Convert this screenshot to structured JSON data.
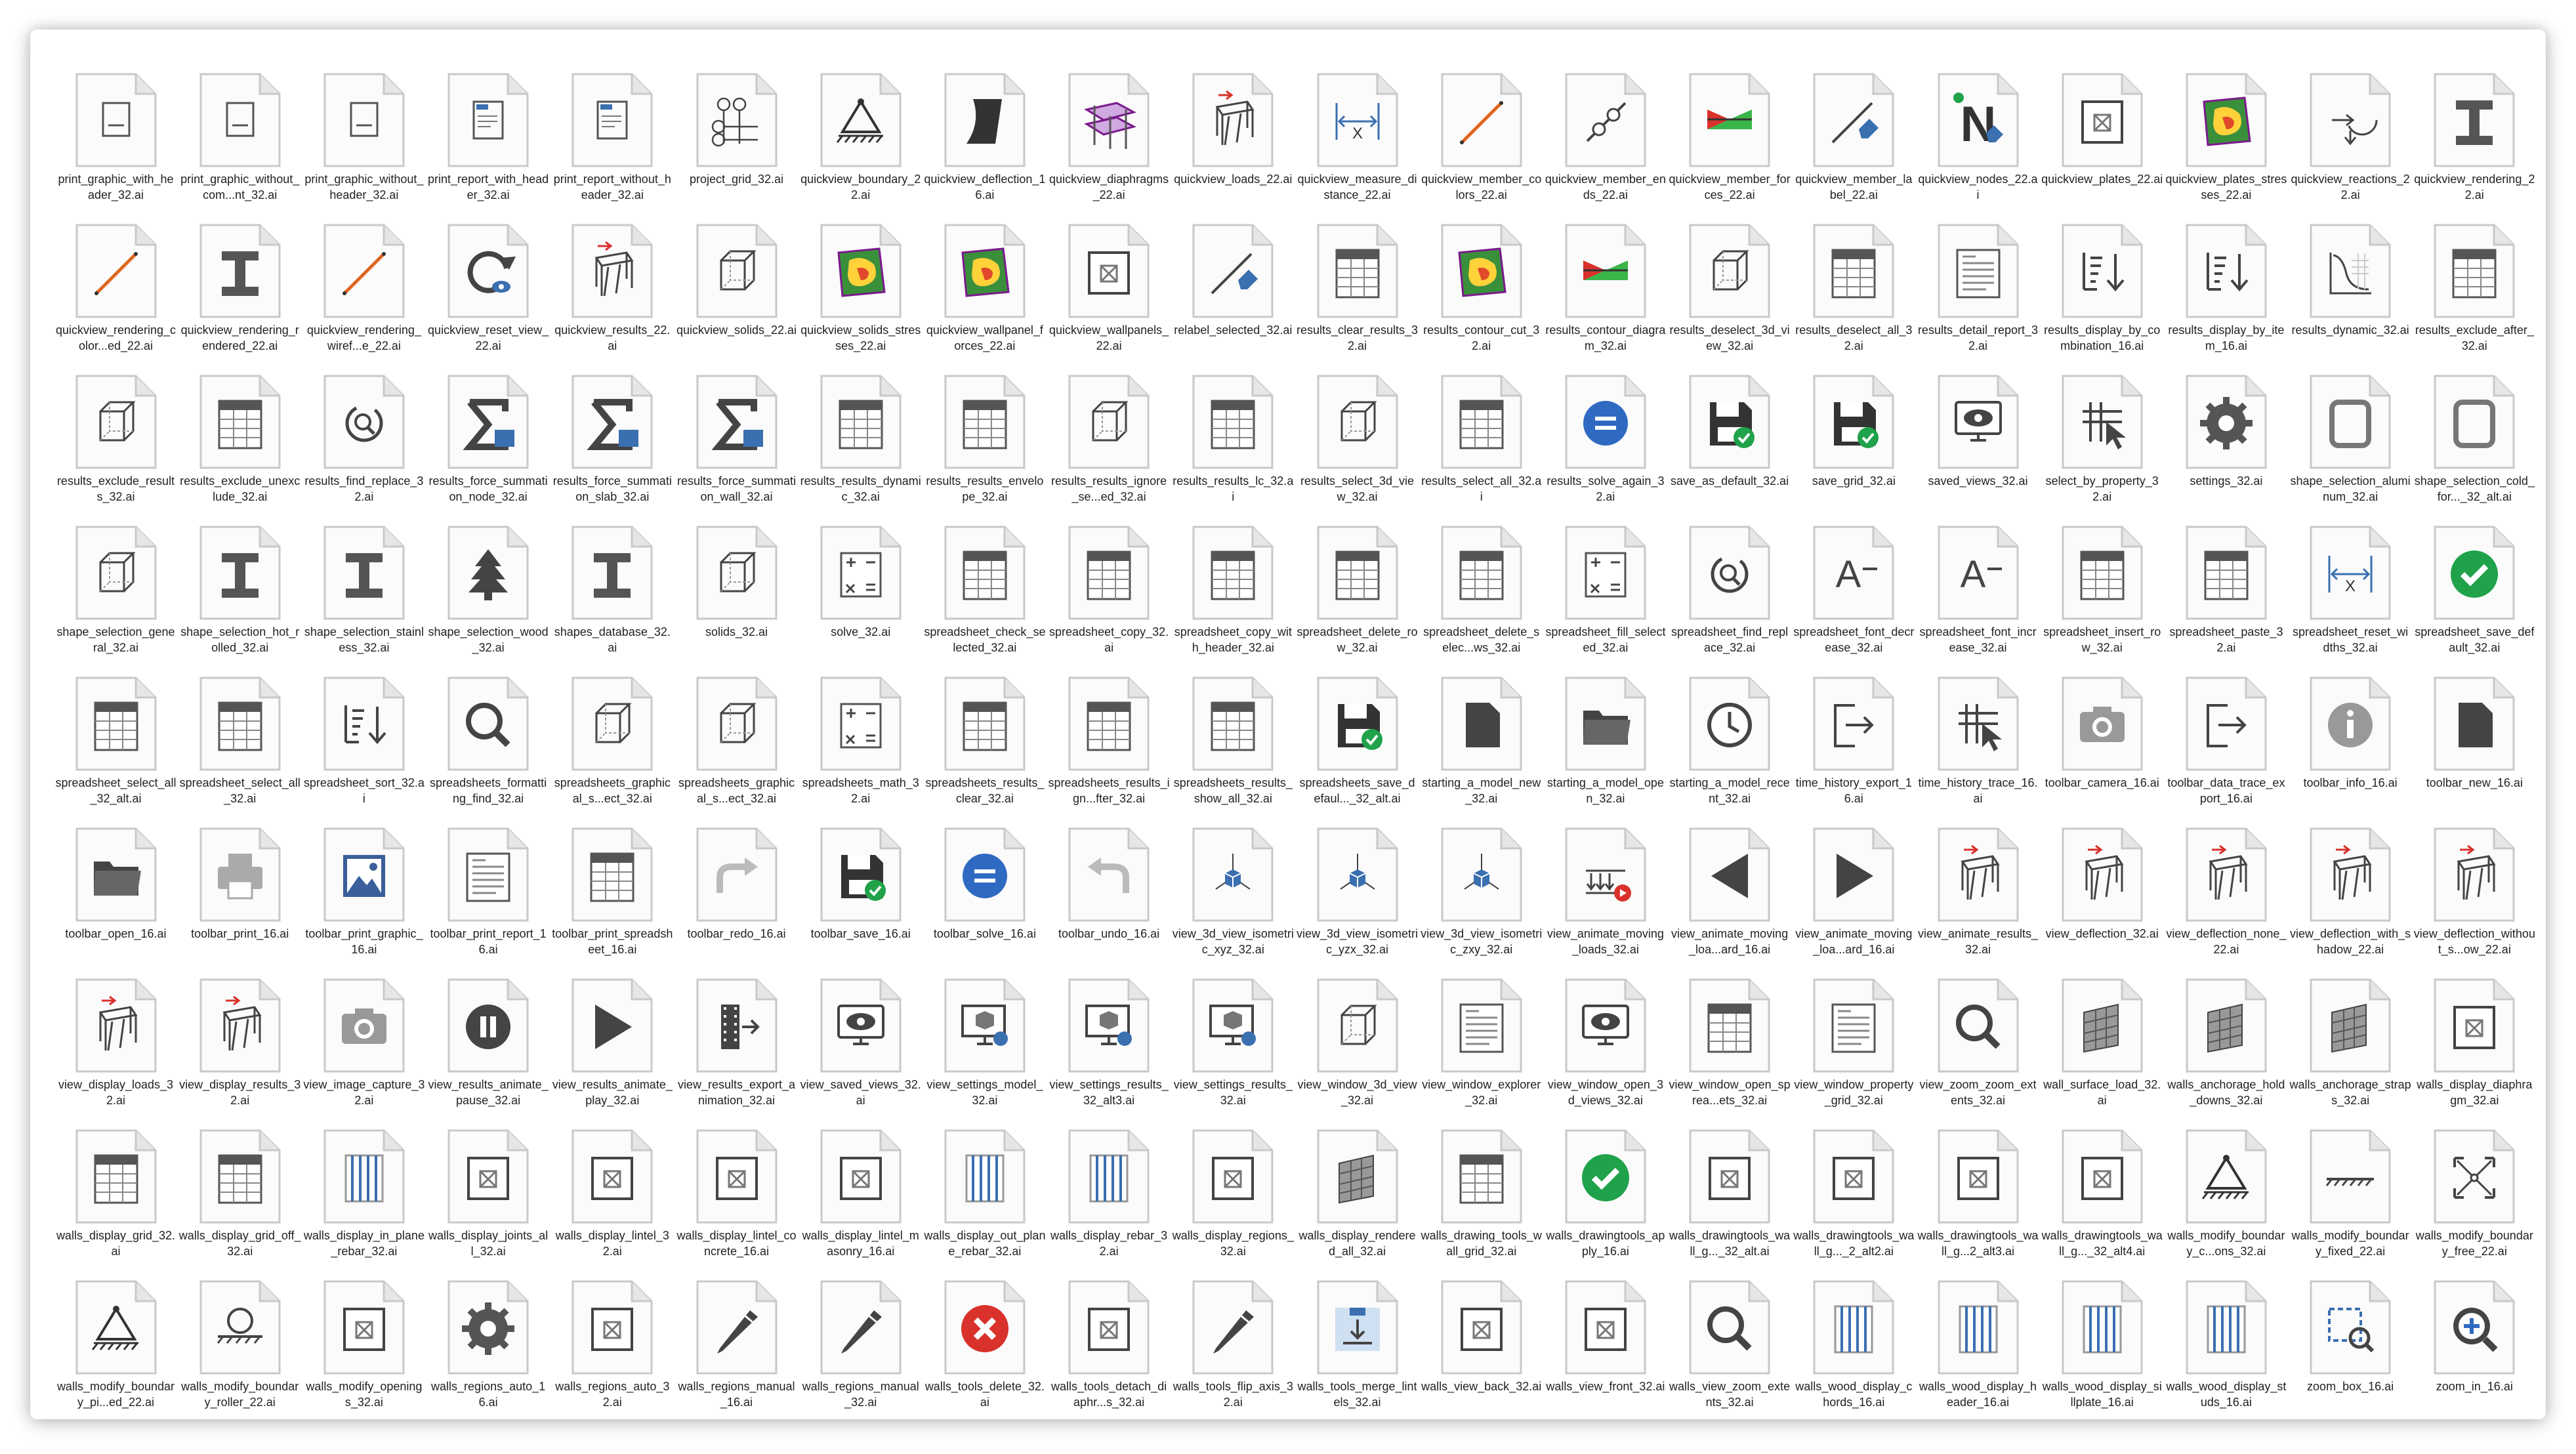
{
  "files": [
    {
      "icon": "print-graphic-icon",
      "name": "print_graphic_with_header_32.ai"
    },
    {
      "icon": "print-graphic-icon",
      "name": "print_graphic_without_com...nt_32.ai"
    },
    {
      "icon": "print-graphic-icon",
      "name": "print_graphic_without_header_32.ai"
    },
    {
      "icon": "print-report-icon",
      "name": "print_report_with_header_32.ai"
    },
    {
      "icon": "print-report-icon",
      "name": "print_report_without_header_32.ai"
    },
    {
      "icon": "grid-icon",
      "name": "project_grid_32.ai"
    },
    {
      "icon": "boundary-icon",
      "name": "quickview_boundary_22.ai"
    },
    {
      "icon": "deflection-icon",
      "name": "quickview_deflection_16.ai"
    },
    {
      "icon": "diaphragm-icon",
      "name": "quickview_diaphragms_22.ai"
    },
    {
      "icon": "frame-icon",
      "name": "quickview_loads_22.ai"
    },
    {
      "icon": "measure-icon",
      "name": "quickview_measure_distance_22.ai"
    },
    {
      "icon": "line-icon",
      "name": "quickview_member_colors_22.ai"
    },
    {
      "icon": "member-ends-icon",
      "name": "quickview_member_ends_22.ai"
    },
    {
      "icon": "forces-icon",
      "name": "quickview_member_forces_22.ai"
    },
    {
      "icon": "tag-icon",
      "name": "quickview_member_label_22.ai"
    },
    {
      "icon": "node-icon",
      "name": "quickview_nodes_22.ai"
    },
    {
      "icon": "plate-icon",
      "name": "quickview_plates_22.ai"
    },
    {
      "icon": "contour-icon",
      "name": "quickview_plates_stresses_22.ai"
    },
    {
      "icon": "reaction-icon",
      "name": "quickview_reactions_22.ai"
    },
    {
      "icon": "ibeam-icon",
      "name": "quickview_rendering_22.ai"
    },
    {
      "icon": "line-icon",
      "name": "quickview_rendering_color...ed_22.ai"
    },
    {
      "icon": "ibeam-icon",
      "name": "quickview_rendering_rendered_22.ai"
    },
    {
      "icon": "line-icon",
      "name": "quickview_rendering_wiref...e_22.ai"
    },
    {
      "icon": "refresh-icon",
      "name": "quickview_reset_view_22.ai"
    },
    {
      "icon": "frame-icon",
      "name": "quickview_results_22.ai"
    },
    {
      "icon": "cube-icon",
      "name": "quickview_solids_22.ai"
    },
    {
      "icon": "contour-icon",
      "name": "quickview_solids_stresses_22.ai"
    },
    {
      "icon": "contour-icon",
      "name": "quickview_wallpanel_forces_22.ai"
    },
    {
      "icon": "plate-icon",
      "name": "quickview_wallpanels_22.ai"
    },
    {
      "icon": "tag-icon",
      "name": "relabel_selected_32.ai"
    },
    {
      "icon": "table-icon",
      "name": "results_clear_results_32.ai"
    },
    {
      "icon": "contour-icon",
      "name": "results_contour_cut_32.ai"
    },
    {
      "icon": "forces-icon",
      "name": "results_contour_diagram_32.ai"
    },
    {
      "icon": "cube-icon",
      "name": "results_deselect_3d_view_32.ai"
    },
    {
      "icon": "table-icon",
      "name": "results_deselect_all_32.ai"
    },
    {
      "icon": "report-icon",
      "name": "results_detail_report_32.ai"
    },
    {
      "icon": "sort-icon",
      "name": "results_display_by_combination_16.ai"
    },
    {
      "icon": "sort-icon",
      "name": "results_display_by_item_16.ai"
    },
    {
      "icon": "chart-icon",
      "name": "results_dynamic_32.ai"
    },
    {
      "icon": "table-icon",
      "name": "results_exclude_after_32.ai"
    },
    {
      "icon": "cube-icon",
      "name": "results_exclude_results_32.ai"
    },
    {
      "icon": "table-icon",
      "name": "results_exclude_unexclude_32.ai"
    },
    {
      "icon": "find-icon",
      "name": "results_find_replace_32.ai"
    },
    {
      "icon": "sigma-icon",
      "name": "results_force_summation_node_32.ai"
    },
    {
      "icon": "sigma-icon",
      "name": "results_force_summation_slab_32.ai"
    },
    {
      "icon": "sigma-icon",
      "name": "results_force_summation_wall_32.ai"
    },
    {
      "icon": "table-icon",
      "name": "results_results_dynamic_32.ai"
    },
    {
      "icon": "table-icon",
      "name": "results_results_envelope_32.ai"
    },
    {
      "icon": "cube-icon",
      "name": "results_results_ignore_se...ed_32.ai"
    },
    {
      "icon": "table-icon",
      "name": "results_results_lc_32.ai"
    },
    {
      "icon": "cube-icon",
      "name": "results_select_3d_view_32.ai"
    },
    {
      "icon": "table-icon",
      "name": "results_select_all_32.ai"
    },
    {
      "icon": "stop-icon",
      "name": "results_solve_again_32.ai"
    },
    {
      "icon": "save-icon",
      "name": "save_as_default_32.ai"
    },
    {
      "icon": "save-icon",
      "name": "save_grid_32.ai"
    },
    {
      "icon": "eye-icon",
      "name": "saved_views_32.ai"
    },
    {
      "icon": "select-icon",
      "name": "select_by_property_32.ai"
    },
    {
      "icon": "gear-icon",
      "name": "settings_32.ai"
    },
    {
      "icon": "shape-icon",
      "name": "shape_selection_aluminum_32.ai"
    },
    {
      "icon": "shape-icon",
      "name": "shape_selection_cold_for..._32_alt.ai"
    },
    {
      "icon": "cube-icon",
      "name": "shape_selection_general_32.ai"
    },
    {
      "icon": "ibeam-icon",
      "name": "shape_selection_hot_rolled_32.ai"
    },
    {
      "icon": "ibeam-icon",
      "name": "shape_selection_stainless_32.ai"
    },
    {
      "icon": "tree-icon",
      "name": "shape_selection_wood_32.ai"
    },
    {
      "icon": "ibeam-icon",
      "name": "shapes_database_32.ai"
    },
    {
      "icon": "cube-icon",
      "name": "solids_32.ai"
    },
    {
      "icon": "calc-icon",
      "name": "solve_32.ai"
    },
    {
      "icon": "table-icon",
      "name": "spreadsheet_check_selected_32.ai"
    },
    {
      "icon": "table-icon",
      "name": "spreadsheet_copy_32.ai"
    },
    {
      "icon": "table-icon",
      "name": "spreadsheet_copy_with_header_32.ai"
    },
    {
      "icon": "table-icon",
      "name": "spreadsheet_delete_row_32.ai"
    },
    {
      "icon": "table-icon",
      "name": "spreadsheet_delete_selec...ws_32.ai"
    },
    {
      "icon": "calc-icon",
      "name": "spreadsheet_fill_selected_32.ai"
    },
    {
      "icon": "find-icon",
      "name": "spreadsheet_find_replace_32.ai"
    },
    {
      "icon": "font-icon",
      "name": "spreadsheet_font_decrease_32.ai"
    },
    {
      "icon": "font-icon",
      "name": "spreadsheet_font_increase_32.ai"
    },
    {
      "icon": "table-icon",
      "name": "spreadsheet_insert_row_32.ai"
    },
    {
      "icon": "table-icon",
      "name": "spreadsheet_paste_32.ai"
    },
    {
      "icon": "measure-icon",
      "name": "spreadsheet_reset_widths_32.ai"
    },
    {
      "icon": "check-icon",
      "name": "spreadsheet_save_default_32.ai"
    },
    {
      "icon": "table-icon",
      "name": "spreadsheet_select_all_32_alt.ai"
    },
    {
      "icon": "table-icon",
      "name": "spreadsheet_select_all_32.ai"
    },
    {
      "icon": "sort-icon",
      "name": "spreadsheet_sort_32.ai"
    },
    {
      "icon": "search-icon",
      "name": "spreadsheets_formatting_find_32.ai"
    },
    {
      "icon": "cube-icon",
      "name": "spreadsheets_graphical_s...ect_32.ai"
    },
    {
      "icon": "cube-icon",
      "name": "spreadsheets_graphical_s...ect_32.ai"
    },
    {
      "icon": "calc-icon",
      "name": "spreadsheets_math_32.ai"
    },
    {
      "icon": "table-icon",
      "name": "spreadsheets_results_clear_32.ai"
    },
    {
      "icon": "table-icon",
      "name": "spreadsheets_results_ign...fter_32.ai"
    },
    {
      "icon": "table-icon",
      "name": "spreadsheets_results_show_all_32.ai"
    },
    {
      "icon": "save-icon",
      "name": "spreadsheets_save_defaul..._32_alt.ai"
    },
    {
      "icon": "file-icon",
      "name": "starting_a_model_new_32.ai"
    },
    {
      "icon": "folder-icon",
      "name": "starting_a_model_open_32.ai"
    },
    {
      "icon": "clock-icon",
      "name": "starting_a_model_recent_32.ai"
    },
    {
      "icon": "export-icon",
      "name": "time_history_export_16.ai"
    },
    {
      "icon": "select-icon",
      "name": "time_history_trace_16.ai"
    },
    {
      "icon": "camera-icon",
      "name": "toolbar_camera_16.ai"
    },
    {
      "icon": "export-icon",
      "name": "toolbar_data_trace_export_16.ai"
    },
    {
      "icon": "info-icon",
      "name": "toolbar_info_16.ai"
    },
    {
      "icon": "file-icon",
      "name": "toolbar_new_16.ai"
    },
    {
      "icon": "folder-icon",
      "name": "toolbar_open_16.ai"
    },
    {
      "icon": "print-icon",
      "name": "toolbar_print_16.ai"
    },
    {
      "icon": "image-icon",
      "name": "toolbar_print_graphic_16.ai"
    },
    {
      "icon": "report-icon",
      "name": "toolbar_print_report_16.ai"
    },
    {
      "icon": "table-icon",
      "name": "toolbar_print_spreadsheet_16.ai"
    },
    {
      "icon": "redo-icon",
      "name": "toolbar_redo_16.ai"
    },
    {
      "icon": "save-icon",
      "name": "toolbar_save_16.ai"
    },
    {
      "icon": "stop-icon",
      "name": "toolbar_solve_16.ai"
    },
    {
      "icon": "undo-icon",
      "name": "toolbar_undo_16.ai"
    },
    {
      "icon": "axes-icon",
      "name": "view_3d_view_isometric_xyz_32.ai"
    },
    {
      "icon": "axes-icon",
      "name": "view_3d_view_isometric_yzx_32.ai"
    },
    {
      "icon": "axes-icon",
      "name": "view_3d_view_isometric_zxy_32.ai"
    },
    {
      "icon": "loads-icon",
      "name": "view_animate_moving_loads_32.ai"
    },
    {
      "icon": "play-left-icon",
      "name": "view_animate_moving_loa...ard_16.ai"
    },
    {
      "icon": "play-icon",
      "name": "view_animate_moving_loa...ard_16.ai"
    },
    {
      "icon": "frame-icon",
      "name": "view_animate_results_32.ai"
    },
    {
      "icon": "frame-icon",
      "name": "view_deflection_32.ai"
    },
    {
      "icon": "frame-icon",
      "name": "view_deflection_none_22.ai"
    },
    {
      "icon": "frame-icon",
      "name": "view_deflection_with_shadow_22.ai"
    },
    {
      "icon": "frame-icon",
      "name": "view_deflection_without_s...ow_22.ai"
    },
    {
      "icon": "frame-icon",
      "name": "view_display_loads_32.ai"
    },
    {
      "icon": "frame-icon",
      "name": "view_display_results_32.ai"
    },
    {
      "icon": "camera-icon",
      "name": "view_image_capture_32.ai"
    },
    {
      "icon": "pause-icon",
      "name": "view_results_animate_pause_32.ai"
    },
    {
      "icon": "play-icon",
      "name": "view_results_animate_play_32.ai"
    },
    {
      "icon": "film-icon",
      "name": "view_results_export_animation_32.ai"
    },
    {
      "icon": "eye-icon",
      "name": "view_saved_views_32.ai"
    },
    {
      "icon": "monitor-icon",
      "name": "view_settings_model_32.ai"
    },
    {
      "icon": "monitor-icon",
      "name": "view_settings_results_32_alt3.ai"
    },
    {
      "icon": "monitor-icon",
      "name": "view_settings_results_32.ai"
    },
    {
      "icon": "cube-icon",
      "name": "view_window_3d_view_32.ai"
    },
    {
      "icon": "report-icon",
      "name": "view_window_explorer_32.ai"
    },
    {
      "icon": "eye-icon",
      "name": "view_window_open_3d_views_32.ai"
    },
    {
      "icon": "table-icon",
      "name": "view_window_open_sprea...ets_32.ai"
    },
    {
      "icon": "report-icon",
      "name": "view_window_property_grid_32.ai"
    },
    {
      "icon": "search-icon",
      "name": "view_zoom_zoom_extents_32.ai"
    },
    {
      "icon": "wall-icon",
      "name": "wall_surface_load_32.ai"
    },
    {
      "icon": "wall-icon",
      "name": "walls_anchorage_hold_downs_32.ai"
    },
    {
      "icon": "wall-icon",
      "name": "walls_anchorage_straps_32.ai"
    },
    {
      "icon": "plate-icon",
      "name": "walls_display_diaphragm_32.ai"
    },
    {
      "icon": "table-icon",
      "name": "walls_display_grid_32.ai"
    },
    {
      "icon": "table-icon",
      "name": "walls_display_grid_off_32.ai"
    },
    {
      "icon": "rebar-icon",
      "name": "walls_display_in_plane_rebar_32.ai"
    },
    {
      "icon": "plate-icon",
      "name": "walls_display_joints_all_32.ai"
    },
    {
      "icon": "plate-icon",
      "name": "walls_display_lintel_32.ai"
    },
    {
      "icon": "plate-icon",
      "name": "walls_display_lintel_concrete_16.ai"
    },
    {
      "icon": "plate-icon",
      "name": "walls_display_lintel_masonry_16.ai"
    },
    {
      "icon": "rebar-icon",
      "name": "walls_display_out_plane_rebar_32.ai"
    },
    {
      "icon": "rebar-icon",
      "name": "walls_display_rebar_32.ai"
    },
    {
      "icon": "plate-icon",
      "name": "walls_display_regions_32.ai"
    },
    {
      "icon": "wall-icon",
      "name": "walls_display_rendered_all_32.ai"
    },
    {
      "icon": "table-icon",
      "name": "walls_drawing_tools_wall_grid_32.ai"
    },
    {
      "icon": "check-icon",
      "name": "walls_drawingtools_apply_16.ai"
    },
    {
      "icon": "plate-icon",
      "name": "walls_drawingtools_wall_g..._32_alt.ai"
    },
    {
      "icon": "plate-icon",
      "name": "walls_drawingtools_wall_g..._2_alt2.ai"
    },
    {
      "icon": "plate-icon",
      "name": "walls_drawingtools_wall_g...2_alt3.ai"
    },
    {
      "icon": "plate-icon",
      "name": "walls_drawingtools_wall_g..._32_alt4.ai"
    },
    {
      "icon": "boundary-icon",
      "name": "walls_modify_boundary_c...ons_32.ai"
    },
    {
      "icon": "hatch-icon",
      "name": "walls_modify_boundary_fixed_22.ai"
    },
    {
      "icon": "arrows-icon",
      "name": "walls_modify_boundary_free_22.ai"
    },
    {
      "icon": "boundary-icon",
      "name": "walls_modify_boundary_pi...ed_22.ai"
    },
    {
      "icon": "roller-icon",
      "name": "walls_modify_boundary_roller_22.ai"
    },
    {
      "icon": "plate-icon",
      "name": "walls_modify_openings_32.ai"
    },
    {
      "icon": "gear-icon",
      "name": "walls_regions_auto_16.ai"
    },
    {
      "icon": "plate-icon",
      "name": "walls_regions_auto_32.ai"
    },
    {
      "icon": "pencil-icon",
      "name": "walls_regions_manual_16.ai"
    },
    {
      "icon": "pencil-icon",
      "name": "walls_regions_manual_32.ai"
    },
    {
      "icon": "delete-icon",
      "name": "walls_tools_delete_32.ai"
    },
    {
      "icon": "plate-icon",
      "name": "walls_tools_detach_diaphr...s_32.ai"
    },
    {
      "icon": "pencil-icon",
      "name": "walls_tools_flip_axis_32.ai"
    },
    {
      "icon": "merge-icon",
      "name": "walls_tools_merge_lintels_32.ai"
    },
    {
      "icon": "plate-icon",
      "name": "walls_view_back_32.ai"
    },
    {
      "icon": "plate-icon",
      "name": "walls_view_front_32.ai"
    },
    {
      "icon": "search-icon",
      "name": "walls_view_zoom_extents_32.ai"
    },
    {
      "icon": "rebar-icon",
      "name": "walls_wood_display_chords_16.ai"
    },
    {
      "icon": "rebar-icon",
      "name": "walls_wood_display_header_16.ai"
    },
    {
      "icon": "rebar-icon",
      "name": "walls_wood_display_sillplate_16.ai"
    },
    {
      "icon": "rebar-icon",
      "name": "walls_wood_display_studs_16.ai"
    },
    {
      "icon": "zoombox-icon",
      "name": "zoom_box_16.ai"
    },
    {
      "icon": "zoomin-icon",
      "name": "zoom_in_16.ai"
    }
  ],
  "colors": {
    "accent": "#3a6fb0",
    "green": "#1fa24a",
    "red": "#d9312b",
    "dark": "#3d3d3d"
  }
}
